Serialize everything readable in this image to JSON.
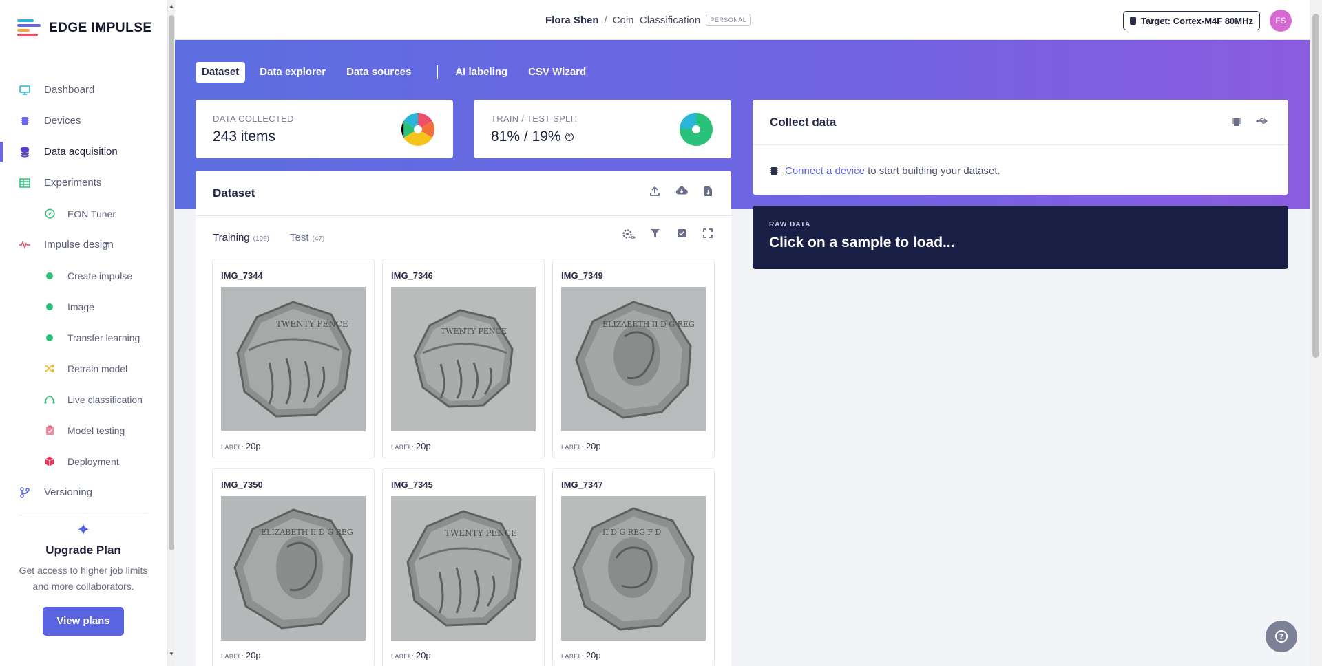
{
  "app": {
    "logo_text": "EDGE IMPULSE",
    "colors": {
      "accent": "#5a63e0",
      "hero_start": "#5c6ee0",
      "hero_end": "#8b5cdf",
      "raw_bg": "#1a1f45",
      "dot_green": "#2ac27a"
    }
  },
  "sidebar": {
    "items": [
      {
        "label": "Dashboard",
        "icon": "monitor-icon"
      },
      {
        "label": "Devices",
        "icon": "chip-icon"
      },
      {
        "label": "Data acquisition",
        "icon": "database-icon"
      },
      {
        "label": "Experiments",
        "icon": "table-icon"
      },
      {
        "label": "EON Tuner",
        "icon": "compass-icon"
      },
      {
        "label": "Impulse design",
        "icon": "pulse-icon"
      },
      {
        "label": "Create impulse",
        "icon": "dot-icon"
      },
      {
        "label": "Image",
        "icon": "dot-icon"
      },
      {
        "label": "Transfer learning",
        "icon": "dot-icon"
      },
      {
        "label": "Retrain model",
        "icon": "shuffle-icon"
      },
      {
        "label": "Live classification",
        "icon": "signal-icon"
      },
      {
        "label": "Model testing",
        "icon": "clipboard-icon"
      },
      {
        "label": "Deployment",
        "icon": "cube-icon"
      },
      {
        "label": "Versioning",
        "icon": "branch-icon"
      }
    ],
    "upgrade": {
      "title": "Upgrade Plan",
      "text": "Get access to higher job limits and more collaborators.",
      "button": "View plans"
    }
  },
  "header": {
    "owner": "Flora Shen",
    "separator": "/",
    "project": "Coin_Classification",
    "badge": "PERSONAL",
    "target": "Target: Cortex-M4F 80MHz",
    "avatar_initials": "FS"
  },
  "tabs": [
    "Dataset",
    "Data explorer",
    "Data sources",
    "AI labeling",
    "CSV Wizard"
  ],
  "stats": {
    "collected": {
      "label": "DATA COLLECTED",
      "value": "243 items"
    },
    "split": {
      "label": "TRAIN / TEST SPLIT",
      "value": "81% / 19%"
    }
  },
  "dataset": {
    "title": "Dataset",
    "training_label": "Training",
    "training_count": "(196)",
    "test_label": "Test",
    "test_count": "(47)",
    "label_prefix": "LABEL:",
    "samples": [
      {
        "name": "IMG_7344",
        "label": "20p",
        "side": "reverse"
      },
      {
        "name": "IMG_7346",
        "label": "20p",
        "side": "reverse"
      },
      {
        "name": "IMG_7349",
        "label": "20p",
        "side": "obverse"
      },
      {
        "name": "IMG_7350",
        "label": "20p",
        "side": "obverse"
      },
      {
        "name": "IMG_7345",
        "label": "20p",
        "side": "reverse"
      },
      {
        "name": "IMG_7347",
        "label": "20p",
        "side": "obverse"
      }
    ]
  },
  "collect": {
    "title": "Collect data",
    "link": "Connect a device",
    "text": " to start building your dataset."
  },
  "raw": {
    "label": "RAW DATA",
    "title": "Click on a sample to load..."
  }
}
